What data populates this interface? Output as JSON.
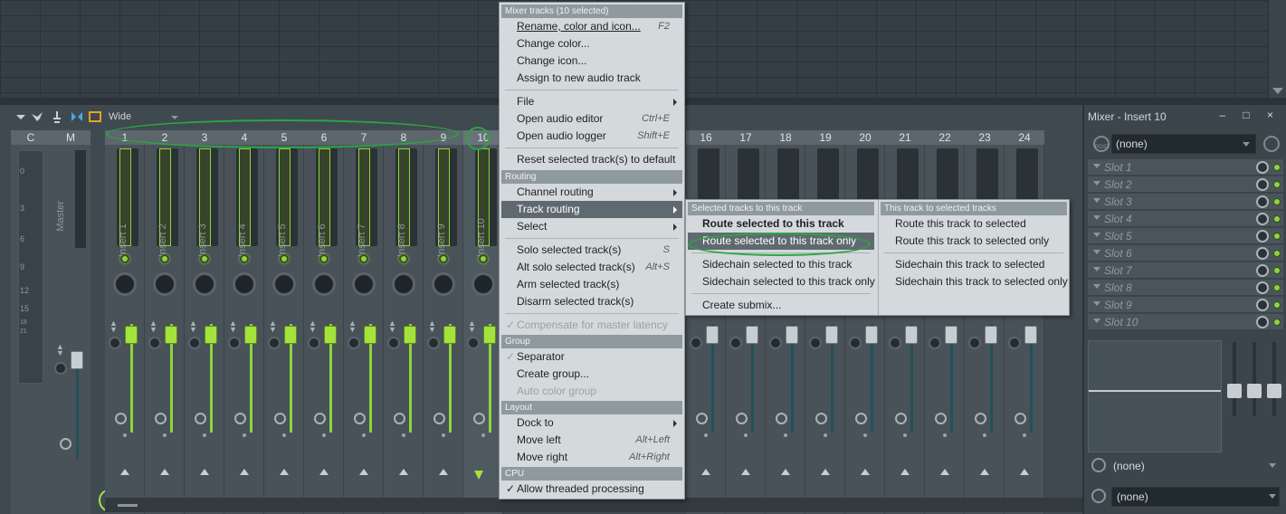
{
  "toolbar": {
    "view_mode": "Wide"
  },
  "strips": {
    "current": {
      "label": "C",
      "scale": [
        "0",
        "3",
        "6",
        "9",
        "12",
        "15",
        "18",
        "21"
      ]
    },
    "master": {
      "label": "M",
      "name": "Master"
    },
    "inserts": [
      {
        "num": "1",
        "name": "Insert 1"
      },
      {
        "num": "2",
        "name": "Insert 2"
      },
      {
        "num": "3",
        "name": "Insert 3"
      },
      {
        "num": "4",
        "name": "Insert 4"
      },
      {
        "num": "5",
        "name": "Insert 5"
      },
      {
        "num": "6",
        "name": "Insert 6"
      },
      {
        "num": "7",
        "name": "Insert 7"
      },
      {
        "num": "8",
        "name": "Insert 8"
      },
      {
        "num": "9",
        "name": "Insert 9"
      },
      {
        "num": "10",
        "name": "Insert 10"
      }
    ],
    "more_numbers": [
      "16",
      "17",
      "18",
      "19",
      "20",
      "21",
      "22",
      "23",
      "24"
    ]
  },
  "menu": {
    "header": "Mixer tracks (10 selected)",
    "items1": [
      {
        "label": "Rename, color and icon...",
        "shortcut": "F2"
      },
      {
        "label": "Change color..."
      },
      {
        "label": "Change icon..."
      },
      {
        "label": "Assign to new audio track"
      }
    ],
    "items2": [
      {
        "label": "File"
      },
      {
        "label": "Open audio editor",
        "shortcut": "Ctrl+E"
      },
      {
        "label": "Open audio logger",
        "shortcut": "Shift+E"
      }
    ],
    "reset": "Reset selected track(s) to default",
    "routing_header": "Routing",
    "channel_routing": "Channel routing",
    "track_routing": "Track routing",
    "select": "Select",
    "items3": [
      {
        "label": "Solo selected track(s)",
        "shortcut": "S"
      },
      {
        "label": "Alt solo selected track(s)",
        "shortcut": "Alt+S"
      },
      {
        "label": "Arm selected track(s)"
      },
      {
        "label": "Disarm selected track(s)"
      }
    ],
    "compensate": "Compensate for master latency",
    "group_header": "Group",
    "separator": "Separator",
    "create_group": "Create group...",
    "auto_color_group": "Auto color group",
    "layout_header": "Layout",
    "dock_to": "Dock to",
    "move_left": {
      "label": "Move left",
      "shortcut": "Alt+Left"
    },
    "move_right": {
      "label": "Move right",
      "shortcut": "Alt+Right"
    },
    "cpu_header": "CPU",
    "threaded": "Allow threaded processing"
  },
  "submenu": {
    "left_header": "Selected tracks to this track",
    "left_items": [
      "Route selected to this track",
      "Route selected to this track only",
      "Sidechain selected to this track",
      "Sidechain selected to this track only",
      "Create submix..."
    ],
    "right_header": "This track to selected tracks",
    "right_items": [
      "Route this track to selected",
      "Route this track to selected only",
      "Sidechain this track to selected",
      "Sidechain this track to selected only"
    ]
  },
  "insert_panel": {
    "title": "Mixer - Insert 10",
    "controls": "– □ ×",
    "post_label": "POST",
    "input": "(none)",
    "slots": [
      "Slot 1",
      "Slot 2",
      "Slot 3",
      "Slot 4",
      "Slot 5",
      "Slot 6",
      "Slot 7",
      "Slot 8",
      "Slot 9",
      "Slot 10"
    ],
    "input_bottom": "(none)",
    "output": "(none)"
  }
}
